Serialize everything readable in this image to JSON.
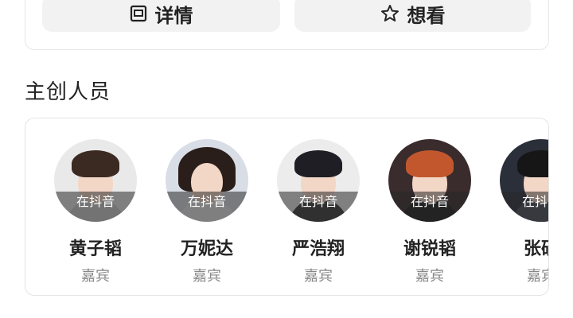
{
  "actions": {
    "details_label": "详情",
    "want_label": "想看"
  },
  "section": {
    "title": "主创人员"
  },
  "cast": [
    {
      "name": "黄子韬",
      "role": "嘉宾",
      "badge": "在抖音",
      "hair": "#3a2a22",
      "bg": "#e9e9e9",
      "outfit": "#cfcfcf"
    },
    {
      "name": "万妮达",
      "role": "嘉宾",
      "badge": "在抖音",
      "hair": "#2a1e1a",
      "bg": "#d9dde6",
      "outfit": "#e8e8e8"
    },
    {
      "name": "严浩翔",
      "role": "嘉宾",
      "badge": "在抖音",
      "hair": "#1e1e24",
      "bg": "#ececec",
      "outfit": "#3b3b3b"
    },
    {
      "name": "谢锐韬",
      "role": "嘉宾",
      "badge": "在抖音",
      "hair": "#c2572e",
      "bg": "#3a2c2c",
      "outfit": "#1e1e1e"
    },
    {
      "name": "张砚‍",
      "role": "嘉宾",
      "badge": "在抖音",
      "hair": "#161616",
      "bg": "#2a2f3a",
      "outfit": "#4a4f5a"
    }
  ]
}
